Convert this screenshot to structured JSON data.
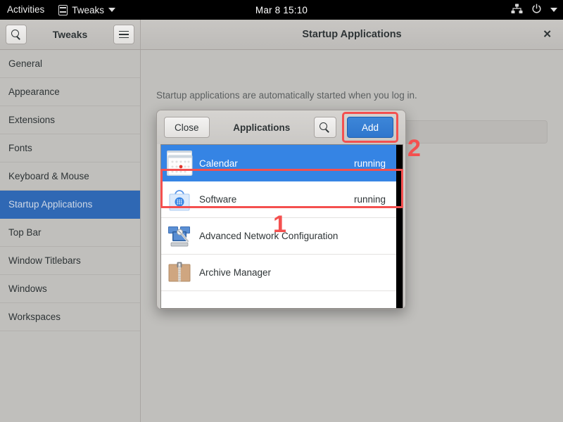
{
  "topbar": {
    "activities": "Activities",
    "app_menu": "Tweaks",
    "app_menu_icon": "tweaks-icon",
    "clock": "Mar 8  15:10",
    "network_icon": "network-wired-icon",
    "power_icon": "power-icon",
    "caret_icon": "chevron-down-icon"
  },
  "window": {
    "sidebar_header": {
      "search_icon": "search-icon",
      "title": "Tweaks",
      "menu_icon": "hamburger-menu-icon"
    },
    "main_header": {
      "title": "Startup Applications",
      "close_icon": "✕"
    },
    "sidebar": {
      "items": [
        {
          "label": "General",
          "selected": false
        },
        {
          "label": "Appearance",
          "selected": false
        },
        {
          "label": "Extensions",
          "selected": false
        },
        {
          "label": "Fonts",
          "selected": false
        },
        {
          "label": "Keyboard & Mouse",
          "selected": false
        },
        {
          "label": "Startup Applications",
          "selected": true
        },
        {
          "label": "Top Bar",
          "selected": false
        },
        {
          "label": "Window Titlebars",
          "selected": false
        },
        {
          "label": "Windows",
          "selected": false
        },
        {
          "label": "Workspaces",
          "selected": false
        }
      ],
      "selected_color": "#2f68b4"
    },
    "main": {
      "description": "Startup applications are automatically started when you log in.",
      "add_button_label": "+"
    }
  },
  "dialog": {
    "close_label": "Close",
    "title": "Applications",
    "search_icon": "search-icon",
    "add_label": "Add",
    "add_color": "#3584e4",
    "rows": [
      {
        "name": "Calendar",
        "status": "running",
        "icon": "calendar-icon",
        "selected": true
      },
      {
        "name": "Software",
        "status": "running",
        "icon": "software-bag-icon",
        "selected": false
      },
      {
        "name": "Advanced Network Configuration",
        "status": "",
        "icon": "network-config-icon",
        "selected": false
      },
      {
        "name": "Archive Manager",
        "status": "",
        "icon": "archive-box-icon",
        "selected": false
      }
    ]
  },
  "annotations": {
    "color": "#f4504f",
    "marker_one": "1",
    "marker_two": "2"
  }
}
